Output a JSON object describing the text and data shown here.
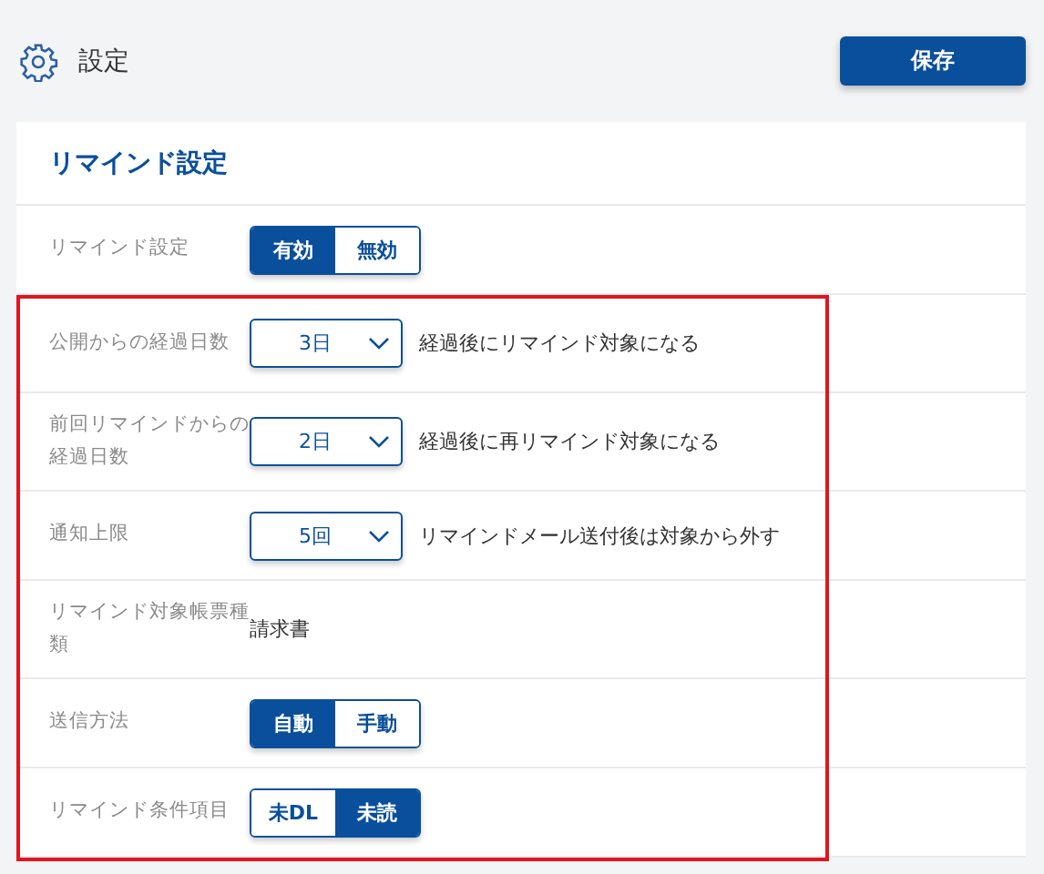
{
  "header": {
    "title": "設定",
    "save_button": "保存"
  },
  "card": {
    "title": "リマインド設定",
    "rows": [
      {
        "kind": "toggle",
        "label": "リマインド設定",
        "options": [
          {
            "label": "有効",
            "selected": true
          },
          {
            "label": "無効",
            "selected": false
          }
        ]
      },
      {
        "kind": "select",
        "label": "公開からの経過日数",
        "value": "3日",
        "note": "経過後にリマインド対象になる"
      },
      {
        "kind": "select",
        "label": "前回リマインドからの経過日数",
        "value": "2日",
        "note": "経過後に再リマインド対象になる"
      },
      {
        "kind": "select",
        "label": "通知上限",
        "value": "5回",
        "note": "リマインドメール送付後は対象から外す"
      },
      {
        "kind": "text",
        "label": "リマインド対象帳票種類",
        "value": "請求書"
      },
      {
        "kind": "toggle",
        "label": "送信方法",
        "options": [
          {
            "label": "自動",
            "selected": true
          },
          {
            "label": "手動",
            "selected": false
          }
        ]
      },
      {
        "kind": "toggle",
        "label": "リマインド条件項目",
        "options": [
          {
            "label": "未DL",
            "selected": false
          },
          {
            "label": "未読",
            "selected": true
          }
        ]
      }
    ]
  }
}
